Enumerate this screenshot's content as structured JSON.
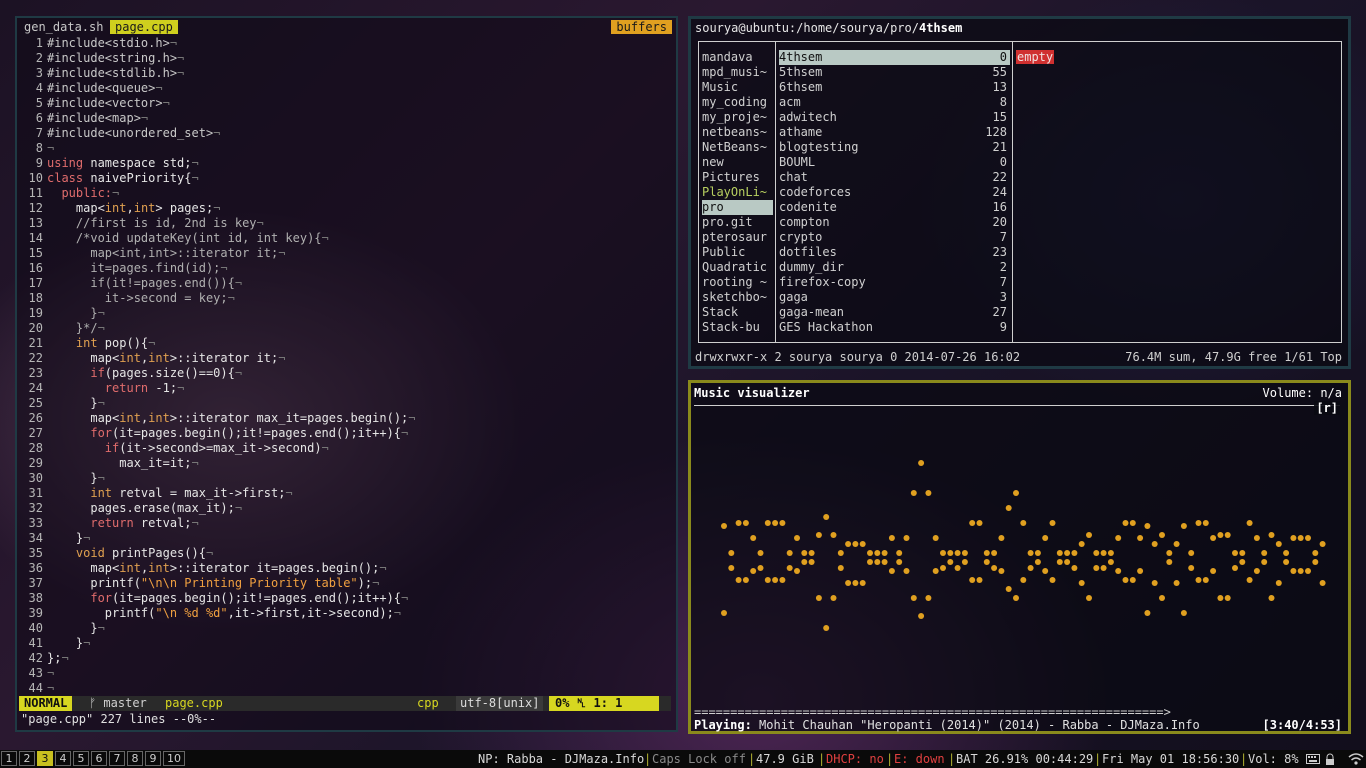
{
  "vim": {
    "tabs": {
      "inactive": "gen_data.sh",
      "active": "page.cpp",
      "buffers": "buffers"
    },
    "line_numbers": [
      "1",
      "2",
      "3",
      "4",
      "5",
      "6",
      "7",
      "8",
      "9",
      "10",
      "11",
      "12",
      "13",
      "14",
      "15",
      "16",
      "17",
      "18",
      "19",
      "20",
      "21",
      "22",
      "23",
      "24",
      "25",
      "26",
      "27",
      "28",
      "29",
      "30",
      "31",
      "32",
      "33",
      "34",
      "35",
      "36",
      "37",
      "38",
      "39",
      "40",
      "41",
      "42",
      "43",
      "44"
    ],
    "code": [
      [
        {
          "c": "pp",
          "t": "#include<stdio.h>"
        }
      ],
      [
        {
          "c": "pp",
          "t": "#include<string.h>"
        }
      ],
      [
        {
          "c": "pp",
          "t": "#include<stdlib.h>"
        }
      ],
      [
        {
          "c": "pp",
          "t": "#include<queue>"
        }
      ],
      [
        {
          "c": "pp",
          "t": "#include<vector>"
        }
      ],
      [
        {
          "c": "pp",
          "t": "#include<map>"
        }
      ],
      [
        {
          "c": "pp",
          "t": "#include<unordered_set>"
        }
      ],
      [],
      [
        {
          "c": "kw",
          "t": "using"
        },
        {
          "c": "",
          "t": " namespace std;"
        }
      ],
      [
        {
          "c": "kw",
          "t": "class"
        },
        {
          "c": "",
          "t": " naivePriority{"
        }
      ],
      [
        {
          "c": "kw",
          "t": "  public:"
        }
      ],
      [
        {
          "c": "",
          "t": "    map<"
        },
        {
          "c": "tp",
          "t": "int"
        },
        {
          "c": "",
          "t": ","
        },
        {
          "c": "tp",
          "t": "int"
        },
        {
          "c": "",
          "t": "> pages;"
        }
      ],
      [
        {
          "c": "cm",
          "t": "    //first is id, 2nd is key"
        }
      ],
      [
        {
          "c": "cm",
          "t": "    /*void updateKey(int id, int key){"
        }
      ],
      [
        {
          "c": "cm",
          "t": "      map<int,int>::iterator it;"
        }
      ],
      [
        {
          "c": "cm",
          "t": "      it=pages.find(id);"
        }
      ],
      [
        {
          "c": "cm",
          "t": "      if(it!=pages.end()){"
        }
      ],
      [
        {
          "c": "cm",
          "t": "        it->second = key;"
        }
      ],
      [
        {
          "c": "cm",
          "t": "      }"
        }
      ],
      [
        {
          "c": "cm",
          "t": "    }*/"
        }
      ],
      [
        {
          "c": "tp",
          "t": "    int"
        },
        {
          "c": "",
          "t": " pop(){"
        }
      ],
      [
        {
          "c": "",
          "t": "      map<"
        },
        {
          "c": "tp",
          "t": "int"
        },
        {
          "c": "",
          "t": ","
        },
        {
          "c": "tp",
          "t": "int"
        },
        {
          "c": "",
          "t": ">::iterator it;"
        }
      ],
      [
        {
          "c": "kw",
          "t": "      if"
        },
        {
          "c": "",
          "t": "(pages.size()==0){"
        }
      ],
      [
        {
          "c": "kw",
          "t": "        return"
        },
        {
          "c": "",
          "t": " -1;"
        }
      ],
      [
        {
          "c": "",
          "t": "      }"
        }
      ],
      [
        {
          "c": "",
          "t": "      map<"
        },
        {
          "c": "tp",
          "t": "int"
        },
        {
          "c": "",
          "t": ","
        },
        {
          "c": "tp",
          "t": "int"
        },
        {
          "c": "",
          "t": ">::iterator max_it=pages.begin();"
        }
      ],
      [
        {
          "c": "kw",
          "t": "      for"
        },
        {
          "c": "",
          "t": "(it=pages.begin();it!=pages.end();it++){"
        }
      ],
      [
        {
          "c": "kw",
          "t": "        if"
        },
        {
          "c": "",
          "t": "(it->second>=max_it->second)"
        }
      ],
      [
        {
          "c": "",
          "t": "          max_it=it;"
        }
      ],
      [
        {
          "c": "",
          "t": "      }"
        }
      ],
      [
        {
          "c": "tp",
          "t": "      int"
        },
        {
          "c": "",
          "t": " retval = max_it->first;"
        }
      ],
      [
        {
          "c": "",
          "t": "      pages.erase(max_it);"
        }
      ],
      [
        {
          "c": "kw",
          "t": "      return"
        },
        {
          "c": "",
          "t": " retval;"
        }
      ],
      [
        {
          "c": "",
          "t": "    }"
        }
      ],
      [
        {
          "c": "tp",
          "t": "    void"
        },
        {
          "c": "",
          "t": " printPages(){"
        }
      ],
      [
        {
          "c": "",
          "t": "      map<"
        },
        {
          "c": "tp",
          "t": "int"
        },
        {
          "c": "",
          "t": ","
        },
        {
          "c": "tp",
          "t": "int"
        },
        {
          "c": "",
          "t": ">::iterator it=pages.begin();"
        }
      ],
      [
        {
          "c": "",
          "t": "      printf("
        },
        {
          "c": "str",
          "t": "\"\\n\\n Printing Priority table\""
        },
        {
          "c": "",
          "t": ");"
        }
      ],
      [
        {
          "c": "kw",
          "t": "      for"
        },
        {
          "c": "",
          "t": "(it=pages.begin();it!=pages.end();it++){"
        }
      ],
      [
        {
          "c": "",
          "t": "        printf("
        },
        {
          "c": "str",
          "t": "\"\\n %d %d\""
        },
        {
          "c": "",
          "t": ",it->first,it->second);"
        }
      ],
      [
        {
          "c": "",
          "t": "      }"
        }
      ],
      [
        {
          "c": "",
          "t": "    }"
        }
      ],
      [
        {
          "c": "",
          "t": "};"
        }
      ],
      [],
      []
    ],
    "eol_marker": "¬",
    "status": {
      "mode": "NORMAL",
      "branch": "ᚠ master",
      "file": "page.cpp",
      "filetype": "cpp",
      "encoding": "utf-8[unix]",
      "position": "0% ␤  1:  1"
    },
    "message": "\"page.cpp\" 227 lines --0%--"
  },
  "ranger": {
    "title_prefix": "sourya@ubuntu:/home/sourya/pro/",
    "title_dir": "4thsem",
    "parent_items": [
      {
        "name": "mandava",
        "green": false
      },
      {
        "name": "mpd_musi~",
        "green": false
      },
      {
        "name": "Music",
        "green": false
      },
      {
        "name": "my_coding",
        "green": false
      },
      {
        "name": "my_proje~",
        "green": false
      },
      {
        "name": "netbeans~",
        "green": false
      },
      {
        "name": "NetBeans~",
        "green": false
      },
      {
        "name": "new",
        "green": false
      },
      {
        "name": "Pictures",
        "green": false
      },
      {
        "name": "PlayOnLi~",
        "green": true
      },
      {
        "name": "pro",
        "green": false,
        "selected": true
      },
      {
        "name": "pro.git",
        "green": false
      },
      {
        "name": "pterosaur",
        "green": false
      },
      {
        "name": "Public",
        "green": false
      },
      {
        "name": "Quadratic",
        "green": false
      },
      {
        "name": "rooting ~",
        "green": false
      },
      {
        "name": "sketchbo~",
        "green": false
      },
      {
        "name": "Stack",
        "green": false
      },
      {
        "name": "Stack-bu",
        "green": false
      }
    ],
    "dirs": [
      {
        "name": "4thsem",
        "count": "0",
        "selected": true
      },
      {
        "name": "5thsem",
        "count": "55"
      },
      {
        "name": "6thsem",
        "count": "13"
      },
      {
        "name": "acm",
        "count": "8"
      },
      {
        "name": "adwitech",
        "count": "15"
      },
      {
        "name": "athame",
        "count": "128"
      },
      {
        "name": "blogtesting",
        "count": "21"
      },
      {
        "name": "BOUML",
        "count": "0"
      },
      {
        "name": "chat",
        "count": "22"
      },
      {
        "name": "codeforces",
        "count": "24"
      },
      {
        "name": "codenite",
        "count": "16"
      },
      {
        "name": "compton",
        "count": "20"
      },
      {
        "name": "crypto",
        "count": "7"
      },
      {
        "name": "dotfiles",
        "count": "23"
      },
      {
        "name": "dummy_dir",
        "count": "2"
      },
      {
        "name": "firefox-copy",
        "count": "7"
      },
      {
        "name": "gaga",
        "count": "3"
      },
      {
        "name": "gaga-mean",
        "count": "27"
      },
      {
        "name": "GES Hackathon",
        "count": "9"
      }
    ],
    "preview": "empty",
    "status_left": "drwxrwxr-x 2 sourya sourya 0 2014-07-26 16:02",
    "status_right": "76.4M sum, 47.9G free  1/61  Top"
  },
  "ncmpcpp": {
    "title": "Music visualizer",
    "volume": "Volume: n/a",
    "flags": "[r]",
    "visualizer_levels": [
      -3,
      0,
      3,
      3,
      2,
      0,
      3,
      3,
      3,
      0,
      2,
      1,
      1,
      -2,
      -4,
      -2,
      0,
      -1,
      -1,
      -1,
      1,
      1,
      1,
      2,
      1,
      2,
      5,
      7,
      5,
      2,
      0,
      1,
      0,
      1,
      3,
      3,
      1,
      0,
      2,
      4,
      5,
      3,
      0,
      1,
      2,
      3,
      1,
      1,
      0,
      -1,
      -2,
      0,
      0,
      1,
      2,
      3,
      3,
      2,
      -3,
      -1,
      -2,
      1,
      -1,
      -3,
      0,
      3,
      3,
      2,
      -2,
      -2,
      0,
      1,
      3,
      2,
      1,
      -2,
      -1,
      1,
      2,
      2,
      2,
      1,
      -1
    ],
    "progress": "=================================================================>",
    "playing_label": "Playing:",
    "song": "Mohit Chauhan \"Heropanti (2014)\" (2014) - Rabba - DJMaza.Info",
    "time": "[3:40/4:53]",
    "dot_color": "#e0a020"
  },
  "bar": {
    "workspaces": [
      "1",
      "2",
      "3",
      "4",
      "5",
      "6",
      "7",
      "8",
      "9",
      "10"
    ],
    "active_workspace": "3",
    "np": "NP: Rabba - DJMaza.Info",
    "caps": "Caps Lock off",
    "disk": "47.9 GiB",
    "dhcp": "DHCP: no",
    "eth": "E: down",
    "bat": "BAT 26.91% 00:44:29",
    "date": "Fri May 01 18:56:30",
    "vol": "Vol: 8%"
  }
}
